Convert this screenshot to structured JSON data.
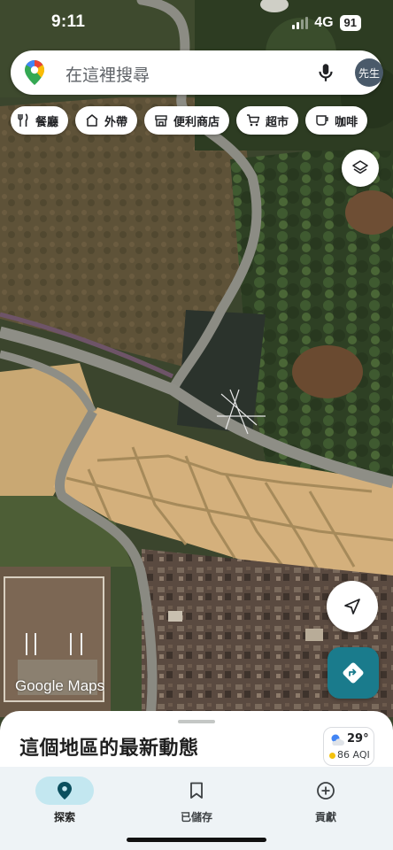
{
  "status_bar": {
    "time": "9:11",
    "network": "4G",
    "battery": "91"
  },
  "search": {
    "placeholder": "在這裡搜尋",
    "avatar_text": "先生",
    "logo_icon": "google-maps-pin-icon",
    "mic_icon": "microphone-icon"
  },
  "chips": [
    {
      "label": "餐廳",
      "icon": "fork-knife-icon"
    },
    {
      "label": "外帶",
      "icon": "takeout-bag-icon"
    },
    {
      "label": "便利商店",
      "icon": "convenience-store-icon"
    },
    {
      "label": "超市",
      "icon": "shopping-cart-icon"
    },
    {
      "label": "咖啡",
      "icon": "coffee-cup-icon"
    }
  ],
  "map": {
    "attribution": "Google Maps",
    "layers_icon": "layers-icon",
    "location_icon": "navigation-arrow-icon",
    "directions_icon": "directions-icon"
  },
  "sheet": {
    "title": "這個地區的最新動態",
    "weather": {
      "temperature": "29°",
      "aqi": "86 AQI",
      "icon": "partly-cloudy-icon",
      "aqi_color": "#f4c20d"
    }
  },
  "nav": {
    "items": [
      {
        "label": "探索",
        "icon": "location-pin-icon",
        "active": true
      },
      {
        "label": "已儲存",
        "icon": "bookmark-icon",
        "active": false
      },
      {
        "label": "貢獻",
        "icon": "add-circle-icon",
        "active": false
      }
    ]
  },
  "colors": {
    "accent": "#1a7b8c",
    "active_nav_pill": "#c3e7f0",
    "nav_background": "#eef3f6"
  }
}
